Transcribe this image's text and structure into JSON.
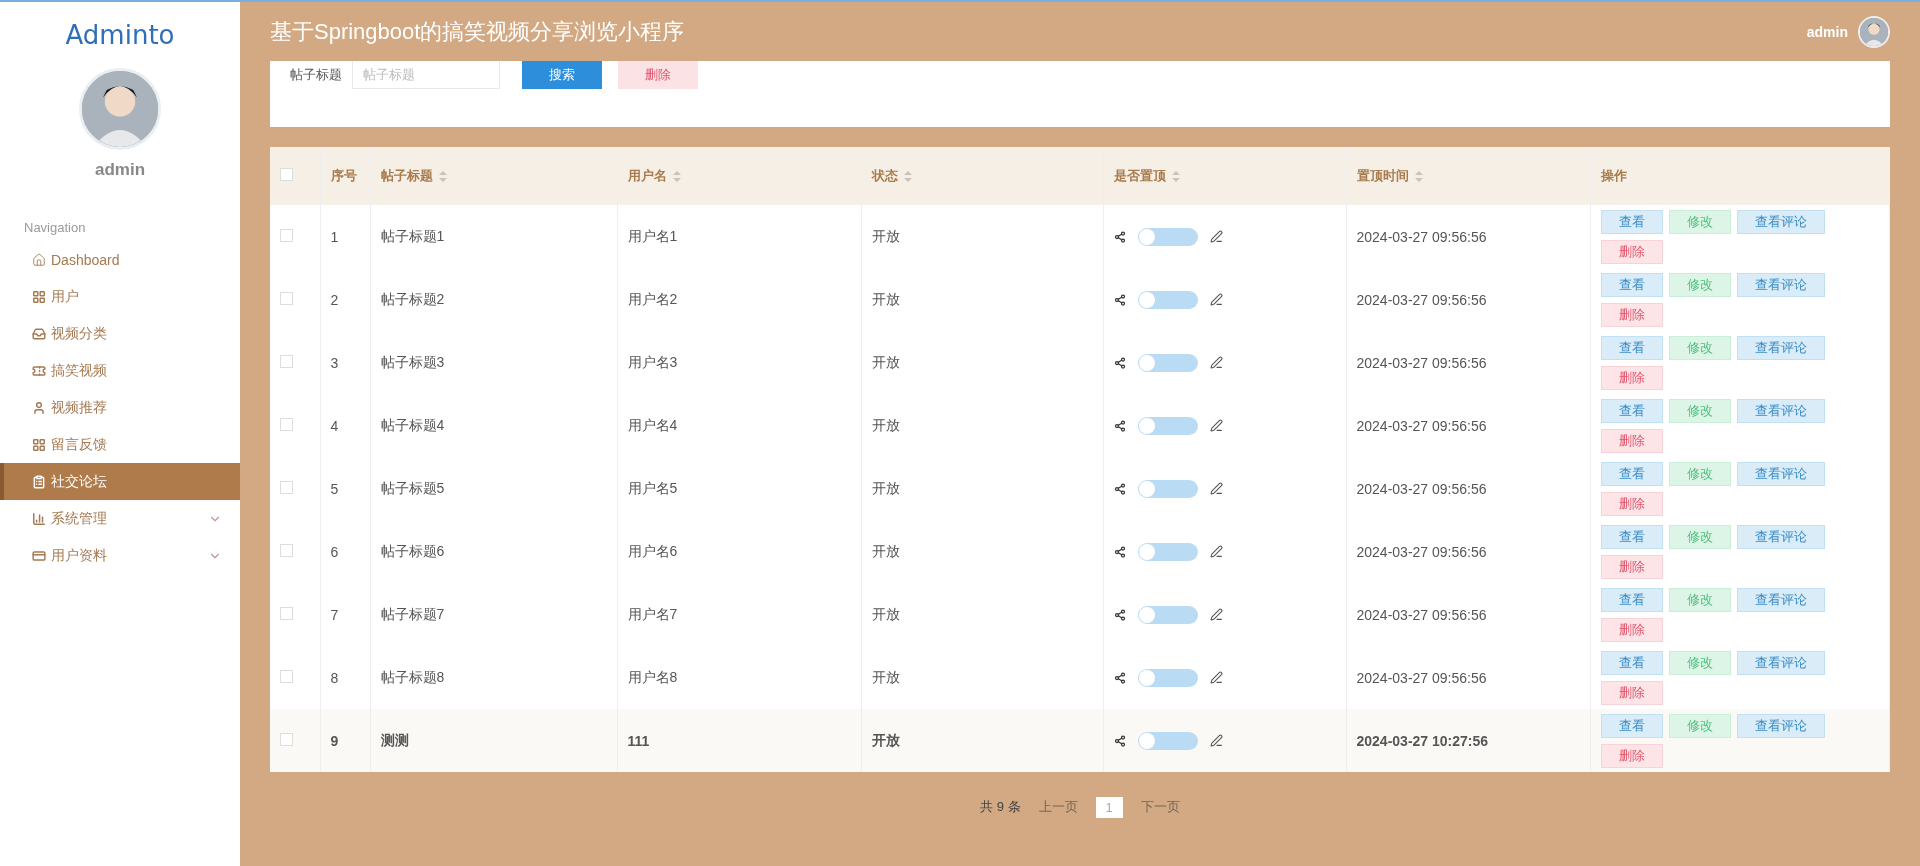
{
  "logo": "Adminto",
  "sidebar": {
    "user": "admin",
    "section": "Navigation",
    "items": [
      {
        "label": "Dashboard",
        "kind": "link",
        "selected": false
      },
      {
        "label": "用户",
        "kind": "link",
        "selected": false
      },
      {
        "label": "视频分类",
        "kind": "link",
        "selected": false
      },
      {
        "label": "搞笑视频",
        "kind": "link",
        "selected": false
      },
      {
        "label": "视频推荐",
        "kind": "link",
        "selected": false
      },
      {
        "label": "留言反馈",
        "kind": "link",
        "selected": false
      },
      {
        "label": "社交论坛",
        "kind": "link",
        "selected": true
      },
      {
        "label": "系统管理",
        "kind": "group",
        "selected": false
      },
      {
        "label": "用户资料",
        "kind": "group",
        "selected": false
      }
    ]
  },
  "header": {
    "title": "基于Springboot的搞笑视频分享浏览小程序",
    "user": "admin"
  },
  "search": {
    "label": "帖子标题",
    "placeholder": "帖子标题",
    "buttons": [
      {
        "label": "搜索",
        "kind": "primary"
      },
      {
        "label": "删除",
        "kind": "danger"
      }
    ]
  },
  "table": {
    "all_checked": false,
    "columns": [
      {
        "label": "序号",
        "sortable": false
      },
      {
        "label": "帖子标题",
        "sortable": true
      },
      {
        "label": "用户名",
        "sortable": true
      },
      {
        "label": "状态",
        "sortable": true
      },
      {
        "label": "是否置顶",
        "sortable": true
      },
      {
        "label": "置顶时间",
        "sortable": true
      },
      {
        "label": "操作",
        "sortable": false
      }
    ],
    "rows": [
      {
        "index": "1",
        "title": "帖子标题1",
        "user": "用户名1",
        "status": "开放",
        "pinned": false,
        "time": "2024-03-27 09:56:56",
        "checked": false,
        "hovered": false,
        "actions": [
          {
            "label": "查看",
            "kind": "view"
          },
          {
            "label": "修改",
            "kind": "edit"
          },
          {
            "label": "查看评论",
            "kind": "view"
          },
          {
            "label": "删除",
            "kind": "danger"
          }
        ]
      },
      {
        "index": "2",
        "title": "帖子标题2",
        "user": "用户名2",
        "status": "开放",
        "pinned": false,
        "time": "2024-03-27 09:56:56",
        "checked": false,
        "hovered": false,
        "actions": [
          {
            "label": "查看",
            "kind": "view"
          },
          {
            "label": "修改",
            "kind": "edit"
          },
          {
            "label": "查看评论",
            "kind": "view"
          },
          {
            "label": "删除",
            "kind": "danger"
          }
        ]
      },
      {
        "index": "3",
        "title": "帖子标题3",
        "user": "用户名3",
        "status": "开放",
        "pinned": false,
        "time": "2024-03-27 09:56:56",
        "checked": false,
        "hovered": false,
        "actions": [
          {
            "label": "查看",
            "kind": "view"
          },
          {
            "label": "修改",
            "kind": "edit"
          },
          {
            "label": "查看评论",
            "kind": "view"
          },
          {
            "label": "删除",
            "kind": "danger"
          }
        ]
      },
      {
        "index": "4",
        "title": "帖子标题4",
        "user": "用户名4",
        "status": "开放",
        "pinned": false,
        "time": "2024-03-27 09:56:56",
        "checked": false,
        "hovered": false,
        "actions": [
          {
            "label": "查看",
            "kind": "view"
          },
          {
            "label": "修改",
            "kind": "edit"
          },
          {
            "label": "查看评论",
            "kind": "view"
          },
          {
            "label": "删除",
            "kind": "danger"
          }
        ]
      },
      {
        "index": "5",
        "title": "帖子标题5",
        "user": "用户名5",
        "status": "开放",
        "pinned": false,
        "time": "2024-03-27 09:56:56",
        "checked": false,
        "hovered": false,
        "actions": [
          {
            "label": "查看",
            "kind": "view"
          },
          {
            "label": "修改",
            "kind": "edit"
          },
          {
            "label": "查看评论",
            "kind": "view"
          },
          {
            "label": "删除",
            "kind": "danger"
          }
        ]
      },
      {
        "index": "6",
        "title": "帖子标题6",
        "user": "用户名6",
        "status": "开放",
        "pinned": false,
        "time": "2024-03-27 09:56:56",
        "checked": false,
        "hovered": false,
        "actions": [
          {
            "label": "查看",
            "kind": "view"
          },
          {
            "label": "修改",
            "kind": "edit"
          },
          {
            "label": "查看评论",
            "kind": "view"
          },
          {
            "label": "删除",
            "kind": "danger"
          }
        ]
      },
      {
        "index": "7",
        "title": "帖子标题7",
        "user": "用户名7",
        "status": "开放",
        "pinned": false,
        "time": "2024-03-27 09:56:56",
        "checked": false,
        "hovered": false,
        "actions": [
          {
            "label": "查看",
            "kind": "view"
          },
          {
            "label": "修改",
            "kind": "edit"
          },
          {
            "label": "查看评论",
            "kind": "view"
          },
          {
            "label": "删除",
            "kind": "danger"
          }
        ]
      },
      {
        "index": "8",
        "title": "帖子标题8",
        "user": "用户名8",
        "status": "开放",
        "pinned": false,
        "time": "2024-03-27 09:56:56",
        "checked": false,
        "hovered": false,
        "actions": [
          {
            "label": "查看",
            "kind": "view"
          },
          {
            "label": "修改",
            "kind": "edit"
          },
          {
            "label": "查看评论",
            "kind": "view"
          },
          {
            "label": "删除",
            "kind": "danger"
          }
        ]
      },
      {
        "index": "9",
        "title": "测测",
        "user": "111",
        "status": "开放",
        "pinned": false,
        "time": "2024-03-27 10:27:56",
        "checked": false,
        "hovered": true,
        "actions": [
          {
            "label": "查看",
            "kind": "view"
          },
          {
            "label": "修改",
            "kind": "edit"
          },
          {
            "label": "查看评论",
            "kind": "view"
          },
          {
            "label": "删除",
            "kind": "danger"
          }
        ]
      }
    ]
  },
  "pagination": {
    "total": "共 9 条",
    "prev": "上一页",
    "pages": [
      {
        "label": "1",
        "selected": true
      }
    ],
    "next": "下一页"
  }
}
